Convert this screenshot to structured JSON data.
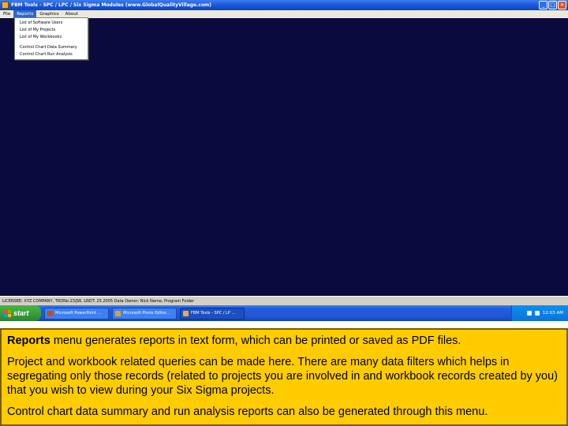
{
  "window": {
    "title": "FBM Tools - SPC / LPC / Six Sigma Modules (www.GlobalQualityVillage.com)",
    "minimize": "_",
    "maximize": "□",
    "close": "×"
  },
  "menubar": {
    "items": [
      {
        "label": "File"
      },
      {
        "label": "Reports"
      },
      {
        "label": "Graphics"
      },
      {
        "label": "About"
      }
    ],
    "active_index": 1
  },
  "reports_menu": {
    "items": [
      {
        "label": "List of Software Users"
      },
      {
        "label": "List of My Projects"
      },
      {
        "label": "List of My Workbooks"
      },
      {
        "label": "Control Chart Data Summary"
      },
      {
        "label": "Control Chart Run Analysis"
      }
    ]
  },
  "statusbar": {
    "text": "LICENSEE: XYZ COMPANY, TRDNo:23/JW, LNDT: 25.2005    Data Owner: Nick Name, Program Folder"
  },
  "taskbar": {
    "start_label": "start",
    "tasks": [
      {
        "label": "Microsoft PowerPoint ...",
        "icon": "powerpoint-icon",
        "icon_color": "#d2461c"
      },
      {
        "label": "Microsoft Photo Editor...",
        "icon": "photo-editor-icon",
        "icon_color": "#e0a030"
      },
      {
        "label": "FBM Tools - SPC / LP ...",
        "icon": "fbm-tools-icon",
        "icon_color": "#e8b13a"
      }
    ],
    "active_task_index": 2,
    "clock": "12:03 AM"
  },
  "caption": {
    "p1_bold": "Reports",
    "p1_rest": " menu generates reports in text form, which can be printed or saved as PDF files.",
    "p2": "Project and workbook related queries can be made here. There are many data filters which helps in segregating only those records (related to projects you are involved in and workbook records created by you) that you wish to view during your Six Sigma projects.",
    "p3": "Control chart data summary and run analysis reports can also be generated through this menu."
  },
  "colors": {
    "workspace": "#0a0a3e",
    "caption_background": "#ffcc00",
    "menu_highlight": "#316ac5"
  }
}
